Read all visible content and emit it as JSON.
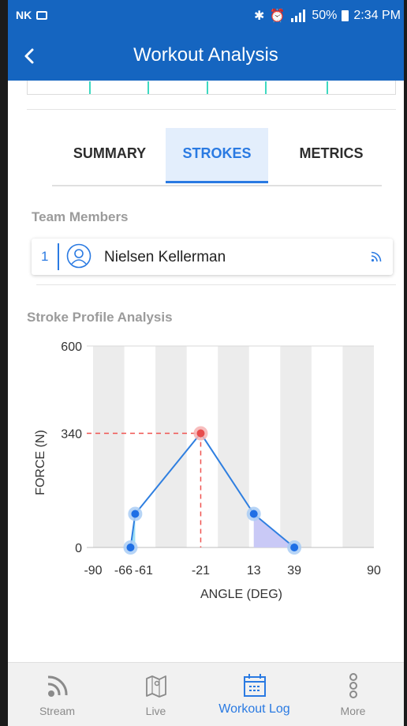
{
  "status_bar": {
    "carrier": "NK",
    "battery": "50%",
    "time": "2:34 PM"
  },
  "header": {
    "title": "Workout Analysis"
  },
  "tabs": [
    {
      "label": "SUMMARY",
      "active": false
    },
    {
      "label": "STROKES",
      "active": true
    },
    {
      "label": "METRICS",
      "active": false
    }
  ],
  "team": {
    "label": "Team Members",
    "members": [
      {
        "number": "1",
        "name": "Nielsen Kellerman"
      }
    ]
  },
  "stroke_profile": {
    "label": "Stroke Profile Analysis"
  },
  "chart_data": {
    "type": "line",
    "xlabel": "ANGLE (DEG)",
    "ylabel": "FORCE (N)",
    "xlim": [
      -90,
      90
    ],
    "ylim": [
      0,
      600
    ],
    "x_ticks": [
      "-90",
      "-66",
      "-61",
      "-21",
      "13",
      "39",
      "90"
    ],
    "y_ticks": [
      "0",
      "340",
      "600"
    ],
    "series": [
      {
        "points": [
          {
            "x": -66,
            "y": 0
          },
          {
            "x": -63,
            "y": 100
          },
          {
            "x": -21,
            "y": 340
          },
          {
            "x": 13,
            "y": 100
          },
          {
            "x": 39,
            "y": 0
          }
        ]
      }
    ],
    "peak": {
      "x": -21,
      "y": 340
    },
    "grid": true,
    "colors": {
      "line": "#2f7fe0",
      "point": "#1f6fe5",
      "halo": "#a9cdf5",
      "peak_halo": "#f6b3b3",
      "peak_point": "#e74c4c",
      "guide": "#ef5350",
      "catch_fill": "#9fe0f5",
      "finish_fill": "#c9c9f6",
      "band": "#ececec"
    }
  },
  "bottom_nav": [
    {
      "label": "Stream",
      "icon": "rss-icon",
      "active": false
    },
    {
      "label": "Live",
      "icon": "map-icon",
      "active": false
    },
    {
      "label": "Workout Log",
      "icon": "calendar-icon",
      "active": true
    },
    {
      "label": "More",
      "icon": "more-icon",
      "active": false
    }
  ],
  "colors": {
    "primary": "#1565c0",
    "accent": "#2a7ae2",
    "teal": "#3dd9c1"
  }
}
